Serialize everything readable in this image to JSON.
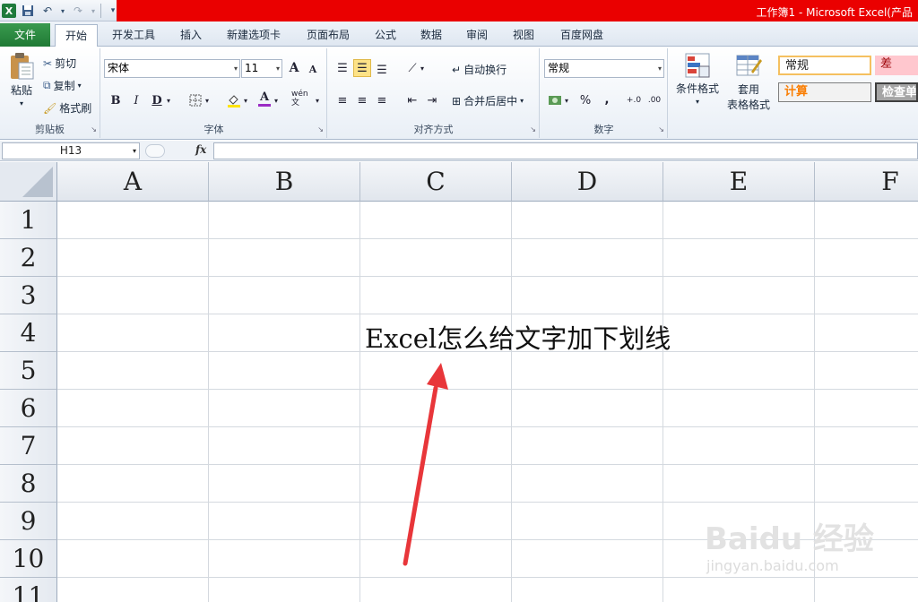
{
  "window": {
    "title": "工作簿1 - Microsoft Excel(产品",
    "title_bar_color": "#ea0000"
  },
  "qat": {
    "logo": "X",
    "icons": [
      "excel-icon",
      "save-icon",
      "undo-icon",
      "redo-icon",
      "customize-icon"
    ]
  },
  "tabs": [
    {
      "label": "文件"
    },
    {
      "label": "开始"
    },
    {
      "label": "开发工具"
    },
    {
      "label": "插入"
    },
    {
      "label": "新建选项卡"
    },
    {
      "label": "页面布局"
    },
    {
      "label": "公式"
    },
    {
      "label": "数据"
    },
    {
      "label": "审阅"
    },
    {
      "label": "视图"
    },
    {
      "label": "百度网盘"
    }
  ],
  "ribbon": {
    "clipboard": {
      "group_label": "剪贴板",
      "paste": "粘贴",
      "cut": "剪切",
      "copy": "复制",
      "format_painter": "格式刷"
    },
    "font": {
      "group_label": "字体",
      "font_name": "宋体",
      "font_size": "11",
      "grow": "A",
      "shrink": "A",
      "bold": "B",
      "italic": "I",
      "underline": "D",
      "font_color": "A",
      "phonetic": "wén 文"
    },
    "alignment": {
      "group_label": "对齐方式",
      "wrap_text": "自动换行",
      "merge_center": "合并后居中"
    },
    "number": {
      "group_label": "数字",
      "format": "常规",
      "percent": "%",
      "comma": ",",
      "inc_decimal": "+.0",
      "dec_decimal": ".00"
    },
    "styles": {
      "conditional_format": "条件格式",
      "table_format_line1": "套用",
      "table_format_line2": "表格格式",
      "normal": "常规",
      "bad": "差",
      "calc": "计算",
      "check": "检查单"
    }
  },
  "formula_bar": {
    "name_box": "H13",
    "fx": "fx",
    "content": ""
  },
  "sheet": {
    "columns": [
      "A",
      "B",
      "C",
      "D",
      "E",
      "F"
    ],
    "rows": [
      "1",
      "2",
      "3",
      "4",
      "5",
      "6",
      "7",
      "8",
      "9",
      "10",
      "11"
    ],
    "annotation_text": "Excel怎么给文字加下划线",
    "arrow_color": "#e8363a"
  },
  "watermark": {
    "brand": "Baidu 经验",
    "url": "jingyan.baidu.com"
  }
}
